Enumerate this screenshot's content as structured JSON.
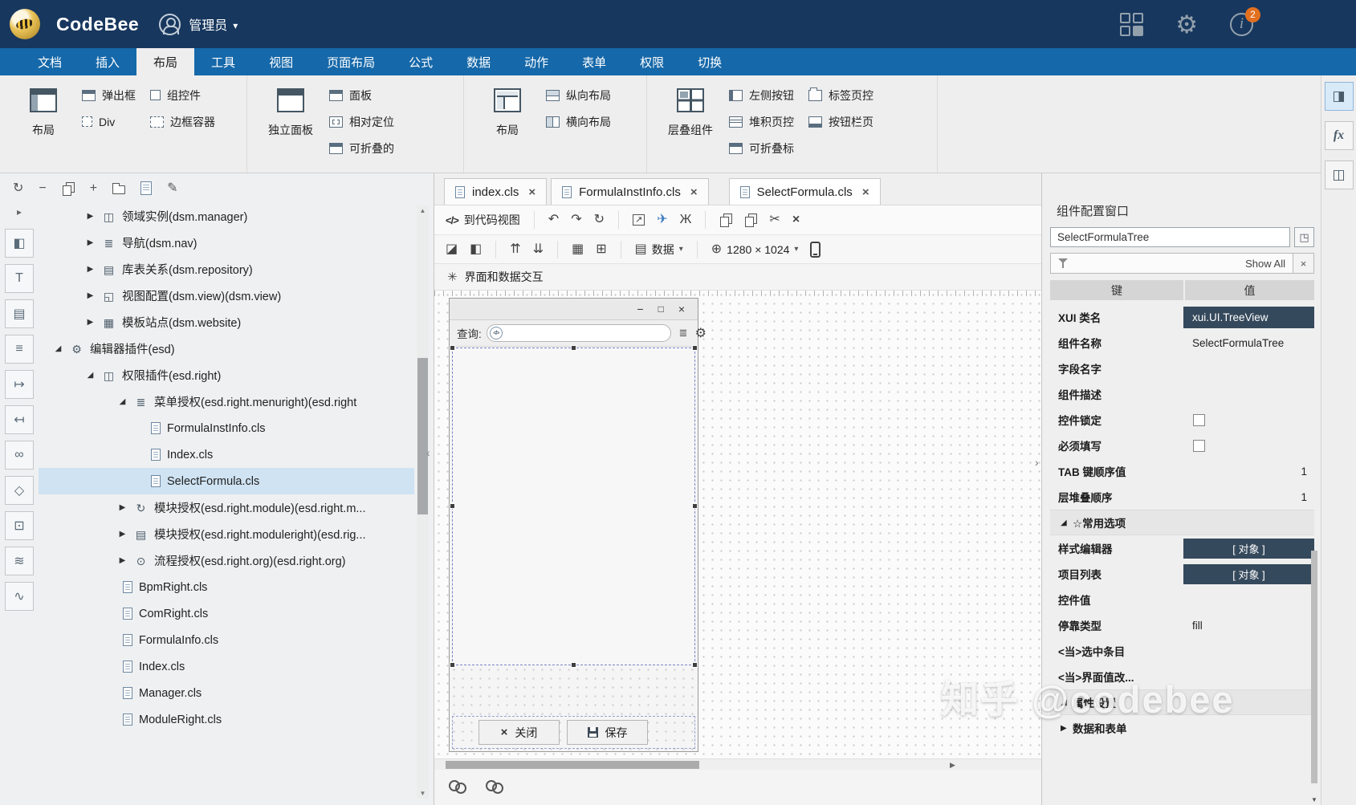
{
  "header": {
    "app_name": "CodeBee",
    "user_role": "管理员",
    "badge_count": "2"
  },
  "menu_tabs": [
    "文档",
    "插入",
    "布局",
    "工具",
    "视图",
    "页面布局",
    "公式",
    "数据",
    "动作",
    "表单",
    "权限",
    "切换"
  ],
  "ribbon": {
    "g1_big": "布局",
    "g1_items": [
      "弹出框",
      "组控件",
      "Div",
      "边框容器"
    ],
    "g2_big": "独立面板",
    "g2_items": [
      "面板",
      "相对定位",
      "可折叠的"
    ],
    "g3_big": "布局",
    "g3_items": [
      "纵向布局",
      "横向布局"
    ],
    "g4_big": "层叠组件",
    "g4_items": [
      "左侧按钮",
      "堆积页控",
      "可折叠标",
      "标签页控",
      "按钮栏页"
    ]
  },
  "tree": [
    "领域实例(dsm.manager)",
    "导航(dsm.nav)",
    "库表关系(dsm.repository)",
    "视图配置(dsm.view)(dsm.view)",
    "模板站点(dsm.website)",
    "编辑器插件(esd)",
    "权限插件(esd.right)",
    "菜单授权(esd.right.menuright)(esd.right",
    "FormulaInstInfo.cls",
    "Index.cls",
    "SelectFormula.cls",
    "模块授权(esd.right.module)(esd.right.m...",
    "模块授权(esd.right.moduleright)(esd.rig...",
    "流程授权(esd.right.org)(esd.right.org)",
    "BpmRight.cls",
    "ComRight.cls",
    "FormulaInfo.cls",
    "Index.cls",
    "Manager.cls",
    "ModuleRight.cls"
  ],
  "editor": {
    "tabs": [
      "index.cls",
      "FormulaInstInfo.cls",
      "SelectFormula.cls"
    ],
    "code_view_label": "到代码视图",
    "data_label": "数据",
    "resolution": "1280 × 1024",
    "interaction_label": "界面和数据交互"
  },
  "design": {
    "query_label": "查询:",
    "close_label": "关闭",
    "save_label": "保存"
  },
  "props": {
    "title": "组件配置窗口",
    "name_value": "SelectFormulaTree",
    "show_all": "Show All",
    "key_header": "键",
    "value_header": "值",
    "rows": [
      {
        "k": "XUI 类名",
        "v": "xui.UI.TreeView"
      },
      {
        "k": "组件名称",
        "v": "SelectFormulaTree"
      },
      {
        "k": "字段名字",
        "v": ""
      },
      {
        "k": "组件描述",
        "v": ""
      },
      {
        "k": "控件锁定"
      },
      {
        "k": "必须填写"
      },
      {
        "k": "TAB 键顺序值",
        "v": "1"
      },
      {
        "k": "层堆叠顺序",
        "v": "1"
      },
      {
        "k": "☆常用选项"
      },
      {
        "k": "样式编辑器",
        "v": "[ 对象 ]"
      },
      {
        "k": "项目列表",
        "v": "[ 对象 ]"
      },
      {
        "k": "控件值",
        "v": ""
      },
      {
        "k": "停靠类型",
        "v": "fill"
      },
      {
        "k": "<当>选中条目",
        "v": ""
      },
      {
        "k": "<当>界面值改...",
        "v": ""
      },
      {
        "k": "属性设置"
      },
      {
        "k": "数据和表单"
      }
    ]
  },
  "tools": [
    "◧",
    "T",
    "▤",
    "≡",
    "↦",
    "↤",
    "∞",
    "◇",
    "⊡",
    "≋",
    "∿"
  ],
  "rightstrip": {
    "panel": "◨",
    "formula": "fx",
    "layers": "◫"
  },
  "icons": {
    "caret_down": "▾",
    "info": "i",
    "gear": "⚙",
    "undo": "↶",
    "redo": "↷",
    "refresh": "↻",
    "publish": "↗",
    "send": "✈",
    "debug": "Ж",
    "cut": "✂",
    "delete": "×",
    "close": "×",
    "minimize": "−",
    "maximize": "□",
    "front": "◪",
    "back": "◧",
    "raise": "⇈",
    "lower": "⇊",
    "grid": "▦",
    "snap": "⊞",
    "data_glyph": "▤",
    "move": "⊕",
    "interaction": "✳",
    "menu": "≣",
    "code": "</>",
    "collapse": "▶",
    "expand": "◢",
    "left": "‹",
    "right": "›",
    "up": "▲",
    "down": "▼",
    "play": "▶",
    "plus": "+",
    "minus": "−",
    "rename": "✎",
    "open": "◳",
    "tool_arrow": "▸",
    "tree": {
      "org": "◫",
      "nav": "≣",
      "db": "▤",
      "view": "◱",
      "site": "▦",
      "gear": "⚙",
      "menu": "≣",
      "module": "↻",
      "flow": "⊙"
    }
  },
  "watermark": "知乎 @codebee"
}
